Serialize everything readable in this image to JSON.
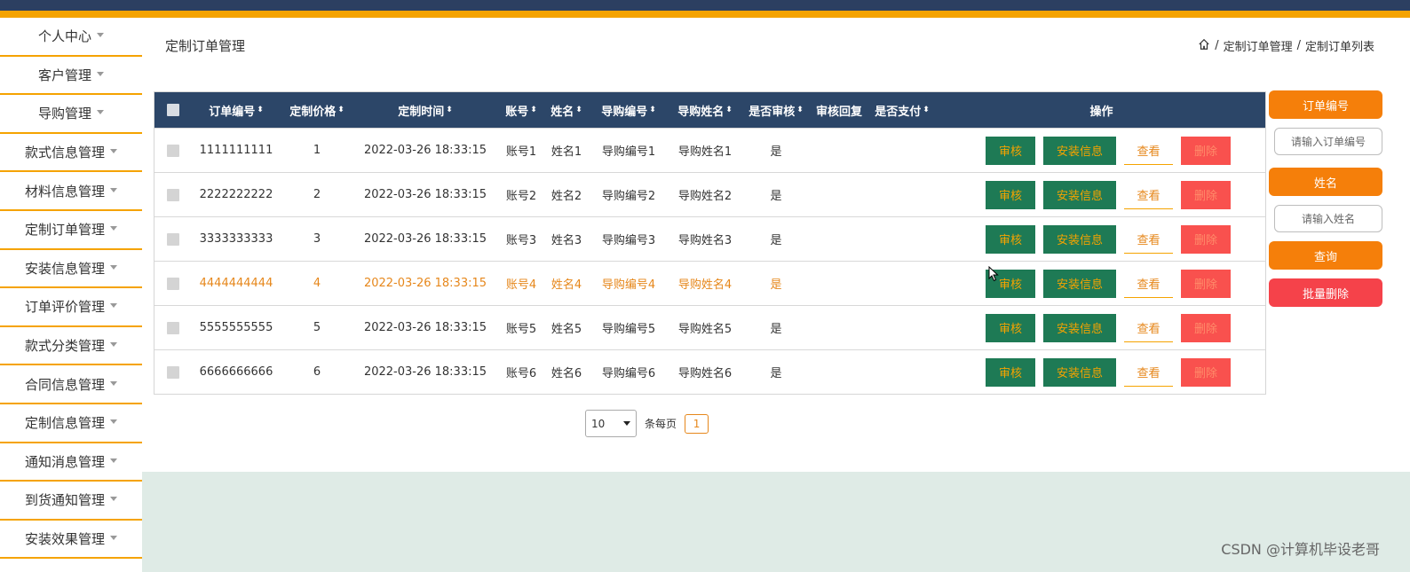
{
  "sidebar": {
    "items": [
      {
        "label": "个人中心"
      },
      {
        "label": "客户管理"
      },
      {
        "label": "导购管理"
      },
      {
        "label": "款式信息管理"
      },
      {
        "label": "材料信息管理"
      },
      {
        "label": "定制订单管理"
      },
      {
        "label": "安装信息管理"
      },
      {
        "label": "订单评价管理"
      },
      {
        "label": "款式分类管理"
      },
      {
        "label": "合同信息管理"
      },
      {
        "label": "定制信息管理"
      },
      {
        "label": "通知消息管理"
      },
      {
        "label": "到货通知管理"
      },
      {
        "label": "安装效果管理"
      }
    ]
  },
  "page": {
    "title": "定制订单管理",
    "breadcrumb": [
      "定制订单管理",
      "定制订单列表"
    ],
    "breadcrumb_sep": "/"
  },
  "table": {
    "headers": {
      "id": "订单编号",
      "price": "定制价格",
      "time": "定制时间",
      "account": "账号",
      "name": "姓名",
      "guide_id": "导购编号",
      "guide_name": "导购姓名",
      "reviewed": "是否审核",
      "reply": "审核回复",
      "paid": "是否支付",
      "ops": "操作"
    },
    "sort_glyph": "⬍",
    "rows": [
      {
        "id": "1111111111",
        "price": "1",
        "time": "2022-03-26 18:33:15",
        "account": "账号1",
        "name": "姓名1",
        "guide_id": "导购编号1",
        "guide_name": "导购姓名1",
        "reviewed": "是",
        "reply": "",
        "paid": ""
      },
      {
        "id": "2222222222",
        "price": "2",
        "time": "2022-03-26 18:33:15",
        "account": "账号2",
        "name": "姓名2",
        "guide_id": "导购编号2",
        "guide_name": "导购姓名2",
        "reviewed": "是",
        "reply": "",
        "paid": ""
      },
      {
        "id": "3333333333",
        "price": "3",
        "time": "2022-03-26 18:33:15",
        "account": "账号3",
        "name": "姓名3",
        "guide_id": "导购编号3",
        "guide_name": "导购姓名3",
        "reviewed": "是",
        "reply": "",
        "paid": ""
      },
      {
        "id": "4444444444",
        "price": "4",
        "time": "2022-03-26 18:33:15",
        "account": "账号4",
        "name": "姓名4",
        "guide_id": "导购编号4",
        "guide_name": "导购姓名4",
        "reviewed": "是",
        "reply": "",
        "paid": ""
      },
      {
        "id": "5555555555",
        "price": "5",
        "time": "2022-03-26 18:33:15",
        "account": "账号5",
        "name": "姓名5",
        "guide_id": "导购编号5",
        "guide_name": "导购姓名5",
        "reviewed": "是",
        "reply": "",
        "paid": ""
      },
      {
        "id": "6666666666",
        "price": "6",
        "time": "2022-03-26 18:33:15",
        "account": "账号6",
        "name": "姓名6",
        "guide_id": "导购编号6",
        "guide_name": "导购姓名6",
        "reviewed": "是",
        "reply": "",
        "paid": ""
      }
    ],
    "highlighted_row": 3,
    "actions": {
      "review": "审核",
      "install": "安装信息",
      "view": "查看",
      "delete": "删除"
    }
  },
  "pagination": {
    "page_size": "10",
    "per_page_label": "条每页",
    "current_page": "1"
  },
  "search_panel": {
    "order_id_label": "订单编号",
    "order_id_placeholder": "请输入订单编号",
    "name_label": "姓名",
    "name_placeholder": "请输入姓名",
    "search_button": "查询",
    "batch_delete_button": "批量删除"
  },
  "watermark": "CSDN @计算机毕设老哥",
  "colors": {
    "topbar": "#2c3f61",
    "accent": "#f5a300",
    "table_header": "#2c4668",
    "action_green": "#1e7a55",
    "delete_red": "#f9514e",
    "panel_orange": "#f57f0a",
    "panel_red": "#f5424a"
  },
  "icons": {
    "breadcrumb_home": "home-icon",
    "dropdown": "caret-down-icon"
  }
}
